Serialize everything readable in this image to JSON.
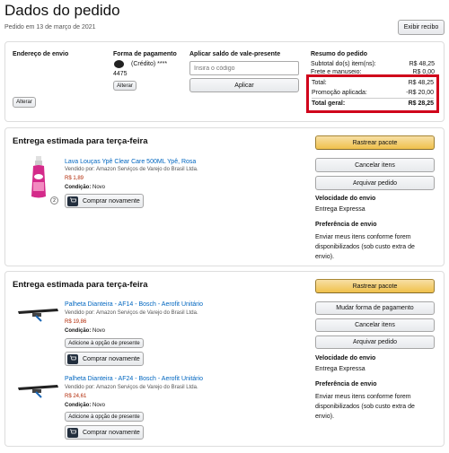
{
  "header": {
    "title": "Dados do pedido",
    "order_date": "Pedido em 13 de março de 2021",
    "print_receipt": "Exibir recibo"
  },
  "summary": {
    "shipping_address_label": "Endereço de envio",
    "payment_label": "Forma de pagamento",
    "payment_card_text": "(Crédito) ****",
    "payment_card_last": "4475",
    "change_payment": "Alterar",
    "change_address": "Alterar",
    "voucher_label": "Aplicar saldo de vale-presente",
    "voucher_placeholder": "Insira o código",
    "voucher_apply": "Aplicar",
    "order_summary_label": "Resumo do pedido",
    "subtotal_label": "Subtotal do(s) item(ns):",
    "subtotal_value": "R$ 48,25",
    "shipping_label": "Frete e manuseio:",
    "shipping_value": "R$ 0,00",
    "total_label": "Total:",
    "total_value": "R$ 48,25",
    "promo_label": "Promoção aplicada:",
    "promo_value": "-R$ 20,00",
    "grand_total_label": "Total geral:",
    "grand_total_value": "R$ 28,25"
  },
  "shipment1": {
    "heading": "Entrega estimada para terça-feira",
    "track": "Rastrear pacote",
    "cancel": "Cancelar itens",
    "archive": "Arquivar pedido",
    "speed_label": "Velocidade do envio",
    "speed_value": "Entrega Expressa",
    "pref_label": "Preferência de envio",
    "pref_value": "Enviar meus itens conforme forem disponibilizados (sob custo extra de envio).",
    "item": {
      "name": "Lava Louças Ypê Clear Care 500ML Ypê, Rosa",
      "seller": "Vendido por: Amazon Serviços de Varejo do Brasil Ltda.",
      "price": "R$ 1,89",
      "condition_label": "Condição:",
      "condition_value": "Novo",
      "quantity": "2",
      "buy_again": "Comprar novamente"
    }
  },
  "shipment2": {
    "heading": "Entrega estimada para terça-feira",
    "track": "Rastrear pacote",
    "change_payment": "Mudar forma de pagamento",
    "cancel": "Cancelar itens",
    "archive": "Arquivar pedido",
    "speed_label": "Velocidade do envio",
    "speed_value": "Entrega Expressa",
    "pref_label": "Preferência de envio",
    "pref_value": "Enviar meus itens conforme forem disponibilizados (sob custo extra de envio).",
    "items": [
      {
        "name": "Palheta Dianteira - AF14 - Bosch - Aerofit Unitário",
        "seller": "Vendido por: Amazon Serviços de Varejo do Brasil Ltda.",
        "price": "R$ 19,86",
        "condition_label": "Condição:",
        "condition_value": "Novo",
        "gift": "Adicione à opção de presente",
        "buy_again": "Comprar novamente"
      },
      {
        "name": "Palheta Dianteira - AF24 - Bosch - Aerofit Unitário",
        "seller": "Vendido por: Amazon Serviços de Varejo do Brasil Ltda.",
        "price": "R$ 24,61",
        "condition_label": "Condição:",
        "condition_value": "Novo",
        "gift": "Adicione à opção de presente",
        "buy_again": "Comprar novamente"
      }
    ]
  },
  "colors": {
    "highlight": "#d0021b",
    "price": "#b12704",
    "link": "#0066c0",
    "track_button": "#f0c14b"
  }
}
